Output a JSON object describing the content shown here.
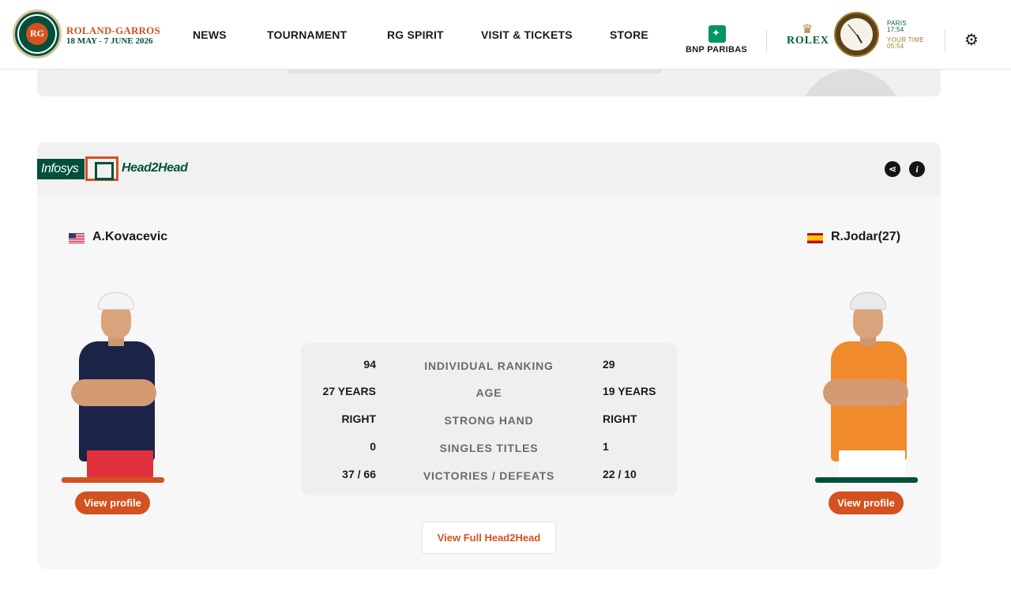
{
  "header": {
    "brand_name": "ROLAND-GARROS",
    "brand_dates": "18 MAY - 7 JUNE 2026",
    "nav": [
      "NEWS",
      "TOURNAMENT",
      "RG SPIRIT",
      "VISIT & TICKETS",
      "STORE"
    ],
    "sponsor": "BNP PARIBAS",
    "rolex": "ROLEX",
    "clock": {
      "paris_label": "PARIS",
      "paris_time": "17:54",
      "your_label": "YOUR TIME",
      "your_time": "05:54"
    }
  },
  "h2h": {
    "infosys": "Infosys",
    "brand": "Head2Head",
    "share_icon": "share-icon",
    "info_icon": "info-icon",
    "player_left": {
      "name": "A.Kovacevic",
      "flag": "usa-flag-icon",
      "profile_label": "View profile"
    },
    "player_right": {
      "name": "R.Jodar(27)",
      "flag": "spain-flag-icon",
      "profile_label": "View profile"
    },
    "stats": [
      {
        "left": "94",
        "label": "INDIVIDUAL RANKING",
        "right": "29"
      },
      {
        "left": "27 YEARS",
        "label": "AGE",
        "right": "19 YEARS"
      },
      {
        "left": "RIGHT",
        "label": "STRONG HAND",
        "right": "RIGHT"
      },
      {
        "left": "0",
        "label": "SINGLES TITLES",
        "right": "1"
      },
      {
        "left": "37 / 66",
        "label": "VICTORIES / DEFEATS",
        "right": "22 / 10"
      }
    ],
    "full_label": "View Full Head2Head"
  },
  "colors": {
    "accent": "#d35220",
    "brand_green": "#00503c",
    "left_bar": "#d35220",
    "right_bar": "#00503c"
  }
}
